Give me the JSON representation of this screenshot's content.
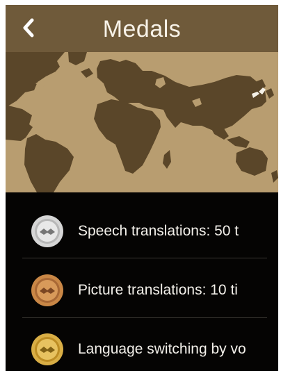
{
  "header": {
    "back_icon": "chevron-left-icon",
    "title": "Medals"
  },
  "map": {
    "image": "world-map",
    "ocean_color": "#b89d70",
    "land_color": "#5a4629"
  },
  "medals": [
    {
      "icon": "silver-medal-icon",
      "color": "#d6d6d6",
      "label": "Speech translations: 50 t"
    },
    {
      "icon": "bronze-medal-icon",
      "color": "#c98746",
      "label": "Picture translations: 10 ti"
    },
    {
      "icon": "gold-medal-icon",
      "color": "#d9ae45",
      "label": "Language switching by vo"
    }
  ],
  "colors": {
    "header": "#6f5a3a",
    "background": "#050403",
    "text": "#f3f0ea"
  }
}
